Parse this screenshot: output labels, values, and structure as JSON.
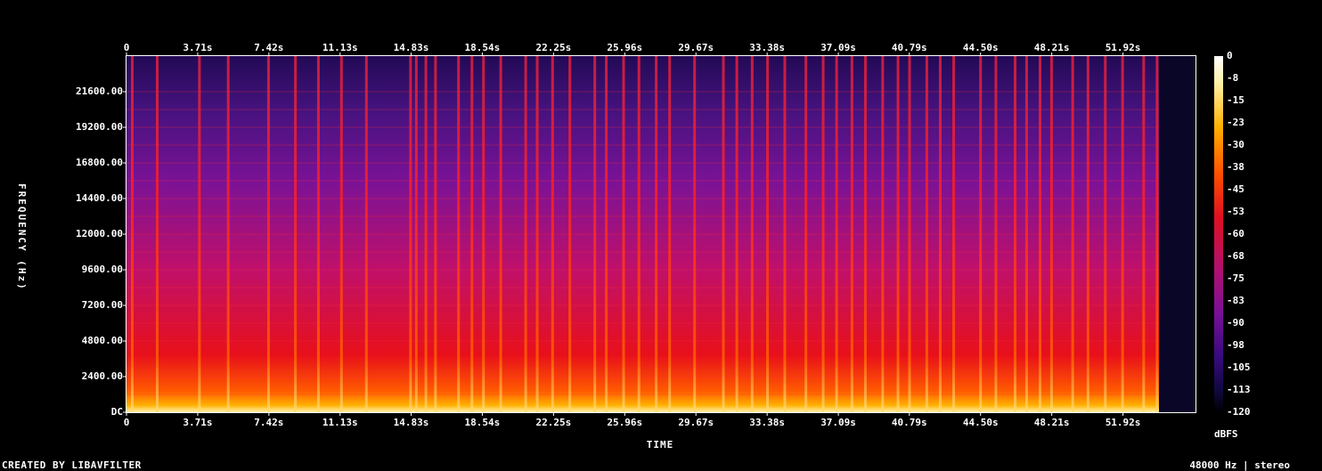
{
  "chart_data": {
    "type": "heatmap",
    "xlabel": "TIME",
    "ylabel": "FREQUENCY (Hz)",
    "x_ticks": [
      "0",
      "3.71s",
      "7.42s",
      "11.13s",
      "14.83s",
      "18.54s",
      "22.25s",
      "25.96s",
      "29.67s",
      "33.38s",
      "37.09s",
      "40.79s",
      "44.50s",
      "48.21s",
      "51.92s"
    ],
    "x_tick_values": [
      0,
      3.71,
      7.42,
      11.13,
      14.83,
      18.54,
      22.25,
      25.96,
      29.67,
      33.38,
      37.09,
      40.79,
      44.5,
      48.21,
      51.92
    ],
    "x_range": [
      0,
      55.7
    ],
    "y_ticks": [
      "DC",
      "2400.00",
      "4800.00",
      "7200.00",
      "9600.00",
      "12000.00",
      "14400.00",
      "16800.00",
      "19200.00",
      "21600.00"
    ],
    "y_tick_values": [
      0,
      2400,
      4800,
      7200,
      9600,
      12000,
      14400,
      16800,
      19200,
      21600
    ],
    "y_range": [
      0,
      24000
    ],
    "colorbar": {
      "unit": "dBFS",
      "ticks": [
        "0",
        "-8",
        "-15",
        "-23",
        "-30",
        "-38",
        "-45",
        "-53",
        "-60",
        "-68",
        "-75",
        "-83",
        "-90",
        "-98",
        "-105",
        "-113",
        "-120"
      ],
      "range": [
        -120,
        0
      ]
    },
    "signal_end_seconds": 53.8,
    "transients_seconds": [
      0.3,
      1.6,
      3.8,
      5.3,
      7.4,
      8.8,
      10.0,
      11.2,
      12.5,
      14.8,
      15.1,
      15.6,
      16.1,
      17.3,
      18.0,
      18.6,
      19.5,
      20.8,
      21.4,
      22.2,
      23.1,
      24.4,
      25.0,
      25.9,
      26.7,
      27.6,
      28.3,
      29.6,
      31.1,
      31.8,
      32.6,
      33.4,
      34.3,
      35.4,
      36.3,
      37.0,
      37.8,
      38.5,
      39.4,
      40.2,
      40.8,
      41.7,
      42.4,
      43.1,
      44.5,
      45.3,
      46.3,
      46.9,
      47.6,
      48.2,
      49.3,
      50.1,
      51.0,
      51.9,
      53.0,
      53.7
    ]
  },
  "footer": {
    "credit": "CREATED BY LIBAVFILTER",
    "info": "48000 Hz | stereo"
  }
}
